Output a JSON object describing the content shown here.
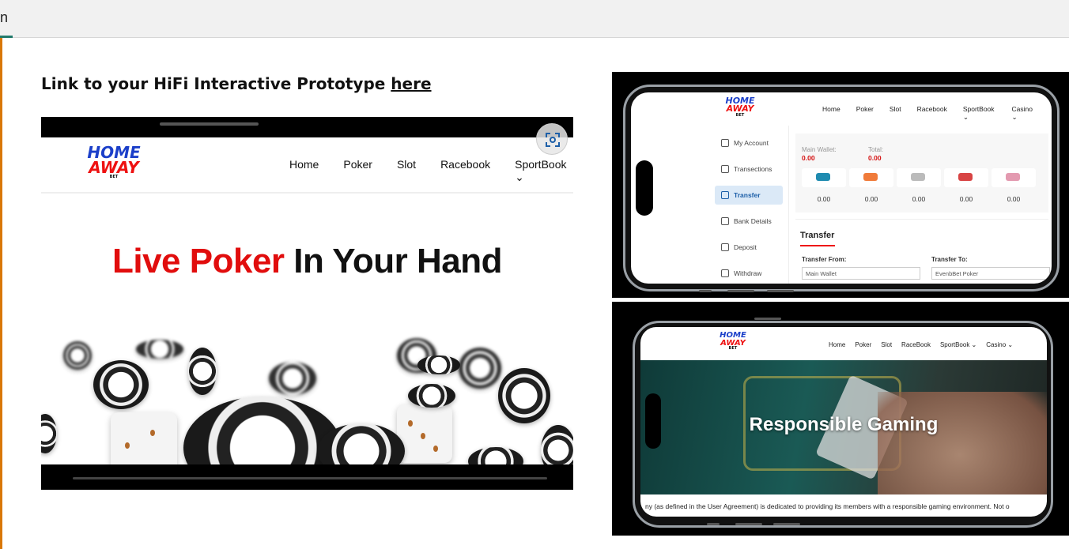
{
  "topbar": {
    "tab_label": "n"
  },
  "heading": {
    "text": "Link to your HiFi Interactive Prototype ",
    "link": "here"
  },
  "brand": {
    "line1": "HOME",
    "line2": "AWAY",
    "line3": "BET"
  },
  "main_mock": {
    "nav": [
      "Home",
      "Poker",
      "Slot",
      "Racebook",
      "SportBook ⌄"
    ],
    "headline_red": "Live Poker",
    "headline_rest": " In Your Hand"
  },
  "account_mock": {
    "nav": [
      "Home",
      "Poker",
      "Slot",
      "Racebook",
      "SportBook ⌄",
      "Casino ⌄"
    ],
    "sidebar": [
      "My Account",
      "Transections",
      "Transfer",
      "Bank Details",
      "Deposit",
      "Withdraw"
    ],
    "main_wallet_label": "Main Wallet:",
    "main_wallet_value": "0.00",
    "total_label": "Total:",
    "total_value": "0.00",
    "provider_values": [
      "0.00",
      "0.00",
      "0.00",
      "0.00",
      "0.00"
    ],
    "transfer_title": "Transfer",
    "transfer_from_label": "Transfer From:",
    "transfer_to_label": "Transfer To:",
    "transfer_from_value": "Main Wallet",
    "transfer_to_value": "EvenbBet Poker"
  },
  "gaming_mock": {
    "nav": [
      "Home",
      "Poker",
      "Slot",
      "RaceBook",
      "SportBook ⌄",
      "Casino ⌄"
    ],
    "hero_title": "Responsible Gaming",
    "body_text": "ny (as defined in the User Agreement) is dedicated to providing its members with a responsible gaming environment. Not o"
  },
  "colors": {
    "accent_red": "#e10d0d",
    "brand_blue": "#1b3fc9",
    "left_rule": "#d97706",
    "tab_underline": "#217a6b"
  }
}
